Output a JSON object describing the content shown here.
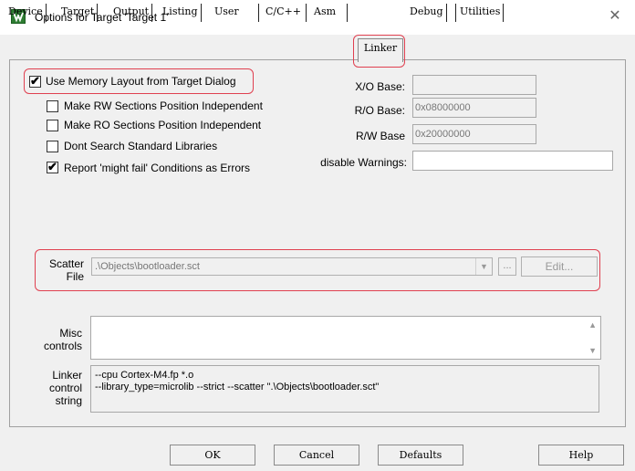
{
  "window": {
    "title": "Options for Target 'Target 1'",
    "close_glyph": "✕"
  },
  "tabs": [
    {
      "label": "Device"
    },
    {
      "label": "Target"
    },
    {
      "label": "Output"
    },
    {
      "label": "Listing"
    },
    {
      "label": "User"
    },
    {
      "label": "C/C++"
    },
    {
      "label": "Asm"
    },
    {
      "label": "Linker",
      "active": true
    },
    {
      "label": "Debug"
    },
    {
      "label": "Utilities"
    }
  ],
  "options": {
    "use_memory_layout": {
      "label": "Use Memory Layout from Target Dialog",
      "checked": true
    },
    "rw_independent": {
      "label": "Make RW Sections Position Independent",
      "checked": false
    },
    "ro_independent": {
      "label": "Make RO Sections Position Independent",
      "checked": false
    },
    "dont_search_libs": {
      "label": "Dont Search Standard Libraries",
      "checked": false
    },
    "report_might_fail": {
      "label": "Report 'might fail' Conditions as Errors",
      "checked": true
    }
  },
  "bases": {
    "xo_label": "X/O Base:",
    "xo_value": "",
    "ro_label": "R/O Base:",
    "ro_value": "0x08000000",
    "rw_label": "R/W Base",
    "rw_value": "0x20000000",
    "warn_label": "disable Warnings:",
    "warn_value": ""
  },
  "scatter": {
    "label_line1": "Scatter",
    "label_line2": "File",
    "value": ".\\Objects\\bootloader.sct",
    "dropdown_glyph": "▼",
    "browse_label": "...",
    "edit_label": "Edit..."
  },
  "misc": {
    "label_line1": "Misc",
    "label_line2": "controls",
    "value": ""
  },
  "linker_control": {
    "label_line1": "Linker",
    "label_line2": "control",
    "label_line3": "string",
    "line1": "--cpu Cortex-M4.fp *.o",
    "line2": "--library_type=microlib --strict --scatter \".\\Objects\\bootloader.sct\""
  },
  "buttons": {
    "ok": "OK",
    "cancel": "Cancel",
    "defaults": "Defaults",
    "help": "Help"
  },
  "colors": {
    "highlight": "#e04050",
    "dialog_bg": "#f0f0f0"
  },
  "icons": {
    "app": "keil-uvision-icon",
    "checkmark": "✔"
  }
}
